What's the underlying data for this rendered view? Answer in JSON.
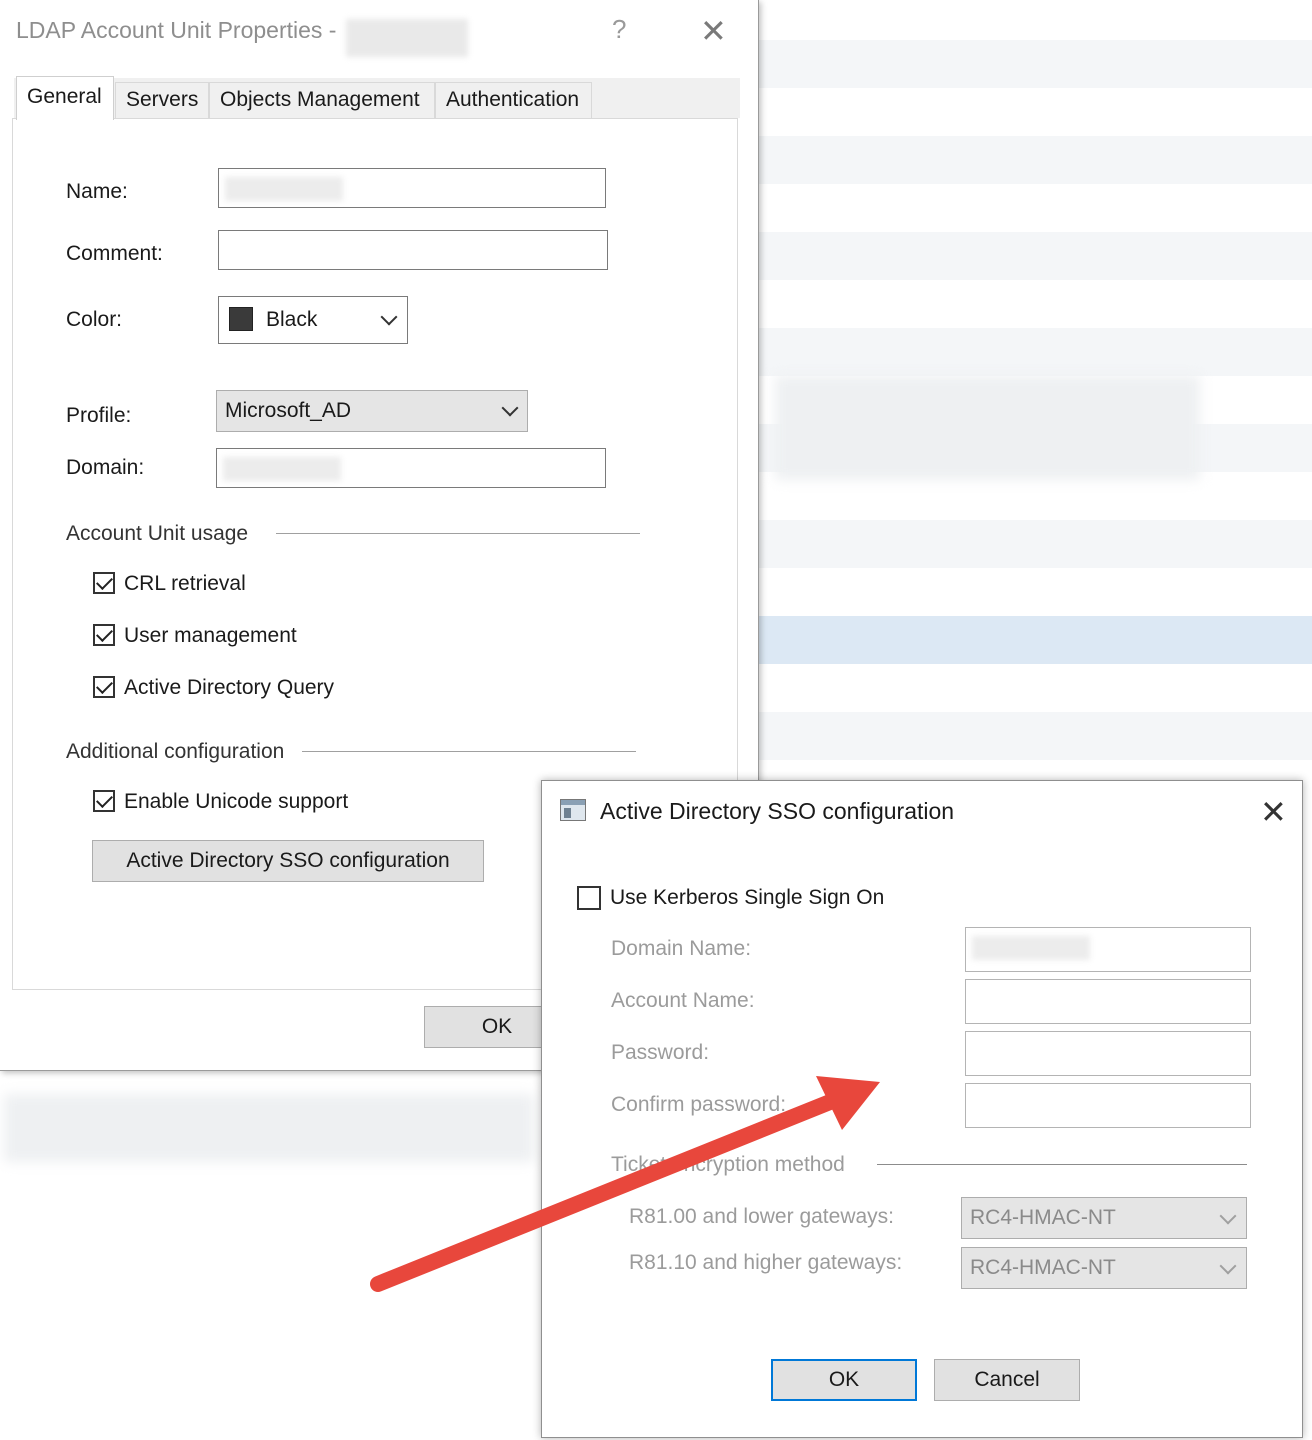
{
  "main_dialog": {
    "title": "LDAP Account Unit Properties -",
    "help_glyph": "?",
    "close_glyph": "✕",
    "tabs": [
      {
        "label": "General",
        "active": true
      },
      {
        "label": "Servers",
        "active": false
      },
      {
        "label": "Objects Management",
        "active": false
      },
      {
        "label": "Authentication",
        "active": false
      }
    ],
    "general": {
      "name_label": "Name:",
      "name_value": "",
      "comment_label": "Comment:",
      "comment_value": "",
      "color_label": "Color:",
      "color_value": "Black",
      "color_swatch": "#3a3a3a",
      "profile_label": "Profile:",
      "profile_value": "Microsoft_AD",
      "domain_label": "Domain:",
      "domain_value": "",
      "usage_section": "Account Unit usage",
      "crl_label": "CRL retrieval",
      "crl_checked": true,
      "user_mgmt_label": "User management",
      "user_mgmt_checked": true,
      "ad_query_label": "Active Directory Query",
      "ad_query_checked": true,
      "additional_section": "Additional configuration",
      "unicode_label": "Enable Unicode support",
      "unicode_checked": true,
      "sso_button": "Active Directory SSO configuration"
    },
    "ok_button": "OK"
  },
  "sso_dialog": {
    "title": "Active Directory SSO configuration",
    "close_glyph": "✕",
    "kerberos_label": "Use Kerberos Single Sign On",
    "kerberos_checked": false,
    "domain_name_label": "Domain Name:",
    "account_name_label": "Account Name:",
    "password_label": "Password:",
    "confirm_password_label": "Confirm password:",
    "ticket_section": "Ticket encryption method",
    "r81_00_label": "R81.00 and lower gateways:",
    "r81_00_value": "RC4-HMAC-NT",
    "r81_10_label": "R81.10 and higher gateways:",
    "r81_10_value": "RC4-HMAC-NT",
    "ok_button": "OK",
    "cancel_button": "Cancel"
  },
  "annotation": {
    "arrow_color": "#e8473c"
  }
}
